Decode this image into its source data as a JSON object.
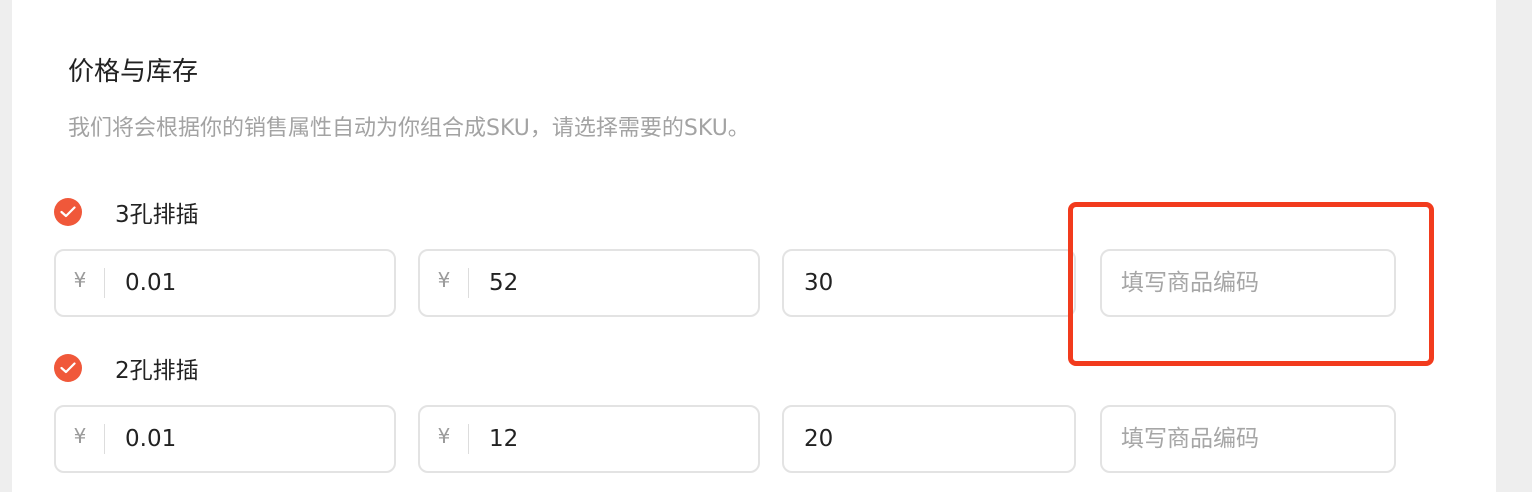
{
  "section": {
    "title": "价格与库存",
    "description": "我们将会根据你的销售属性自动为你组合成SKU，请选择需要的SKU。"
  },
  "currency_symbol": "¥",
  "code_placeholder": "填写商品编码",
  "colors": {
    "accent": "#f0583a",
    "highlight": "#f23b1d"
  },
  "skus": [
    {
      "name": "3孔排插",
      "checked": true,
      "price": "0.01",
      "original_price": "52",
      "stock": "30",
      "code": ""
    },
    {
      "name": "2孔排插",
      "checked": true,
      "price": "0.01",
      "original_price": "12",
      "stock": "20",
      "code": ""
    }
  ]
}
